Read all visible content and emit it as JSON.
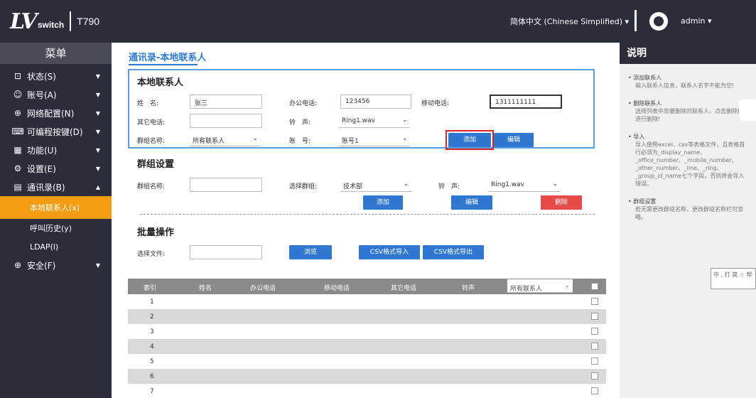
{
  "header": {
    "logo_mark": "LV",
    "logo_switch": "switch",
    "model": "T790",
    "language": "简体中文 (Chinese Simplified) ▾",
    "user": "admin ▾"
  },
  "sidebar": {
    "title": "菜单",
    "items": [
      {
        "label": "状态(S)",
        "icon": "status-icon",
        "arrow": "▼"
      },
      {
        "label": "账号(A)",
        "icon": "account-icon",
        "arrow": "▼"
      },
      {
        "label": "网络配置(N)",
        "icon": "network-icon",
        "arrow": "▼"
      },
      {
        "label": "可编程按键(D)",
        "icon": "keyboard-icon",
        "arrow": "▼"
      },
      {
        "label": "功能(U)",
        "icon": "grid-icon",
        "arrow": "▼"
      },
      {
        "label": "设置(E)",
        "icon": "gear-icon",
        "arrow": "▼"
      },
      {
        "label": "通讯录(B)",
        "icon": "book-icon",
        "arrow": "▲"
      },
      {
        "label": "安全(F)",
        "icon": "shield-icon",
        "arrow": "▼"
      }
    ],
    "sub_items": [
      "本地联系人(x)",
      "呼叫历史(y)",
      "LDAP(l)"
    ]
  },
  "main": {
    "breadcrumb": "通讯录-本地联系人",
    "local_contact": {
      "title": "本地联系人",
      "name_label": "姓　名:",
      "name_value": "张三",
      "office_label": "办公电话:",
      "office_value": "123456",
      "mobile_label": "移动电话:",
      "mobile_value": "1311111111",
      "other_label": "其它电话:",
      "other_value": "",
      "ring_label": "铃　声:",
      "ring_value": "Ring1.wav",
      "group_label": "群组名称:",
      "group_value": "所有联系人",
      "account_label": "账　号:",
      "account_value": "账号1",
      "add_button": "添加",
      "edit_button": "编辑"
    },
    "group_settings": {
      "title": "群组设置",
      "group_name_label": "群组名称:",
      "group_name_value": "",
      "select_group_label": "选择群组:",
      "select_group_value": "技术部",
      "ring_label": "铃　声:",
      "ring_value": "Ring1.wav",
      "add_button": "添加",
      "edit_button": "编辑",
      "delete_button": "删除"
    },
    "batch": {
      "title": "批量操作",
      "file_label": "选择文件:",
      "file_value": "",
      "browse_button": "浏览",
      "import_button": "CSV格式导入",
      "export_button": "CSV格式导出"
    },
    "table": {
      "headers": [
        "索引",
        "姓名",
        "办公电话",
        "移动电话",
        "其它电话",
        "铃声"
      ],
      "filter_value": "所有联系人",
      "rows": [
        "1",
        "2",
        "3",
        "4",
        "5",
        "6",
        "7"
      ]
    }
  },
  "help": {
    "title": "说明",
    "items": [
      {
        "title": "添加联系人",
        "desc": "输入联系人信息，联系人名字不能为空!"
      },
      {
        "title": "删除联系人",
        "desc": "选择列表中您要删除的联系人，点击删除按钮进行删除!"
      },
      {
        "title": "导入",
        "desc": "导入使用excel、csv等表格文件，且表格首行必须为_display_name、_office_number、_mobile_number、_other_number、_line、_ring、_group_id_name七个字段，否则将会导入错误。"
      },
      {
        "title": "群组设置",
        "desc": "若无需更改群组名称，更改群组名称栏可忽略。"
      }
    ],
    "note": "中 , 打 简 ☆ 帮"
  }
}
